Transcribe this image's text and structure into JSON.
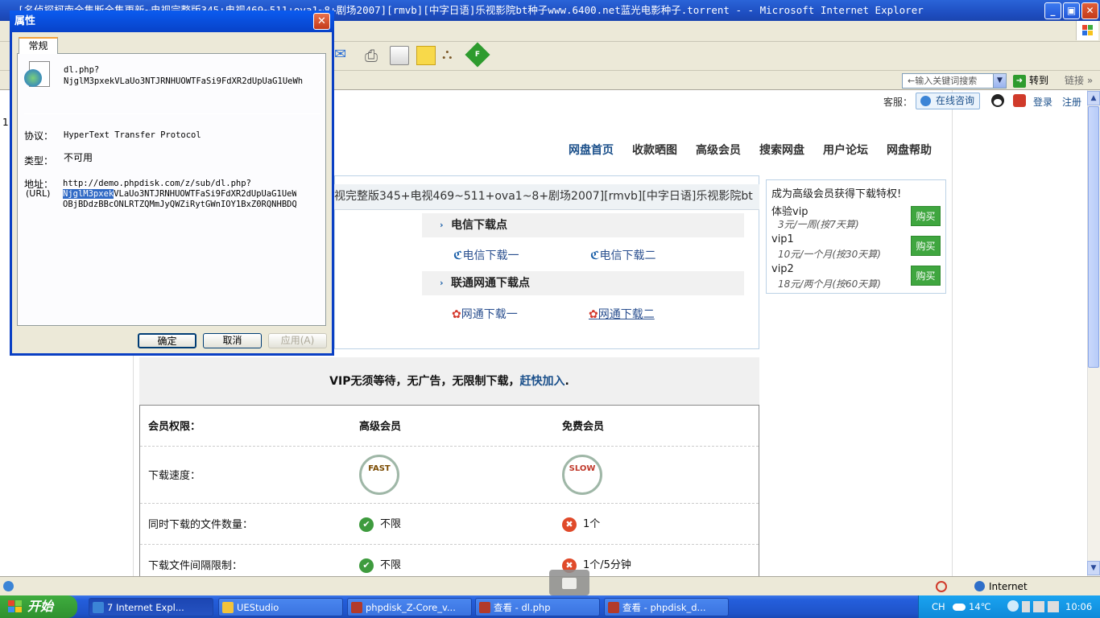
{
  "window": {
    "title": "[名侦探柯南全集断全集更新~电视完整版345+电视469~511+ova1~8+剧场2007][rmvb][中字日语]乐视影院bt种子www.6400.net蓝光电影种子.torrent - - Microsoft Internet Explorer",
    "min": "_",
    "max": "▣",
    "close": "✕"
  },
  "ie": {
    "search_placeholder": "←输入关键词搜索",
    "go_label": "转到",
    "links_label": "链接",
    "status_zone": "Internet"
  },
  "site": {
    "service_label": "客服：",
    "online_label": "在线咨询",
    "login": "登录",
    "register": "注册",
    "nav": [
      "网盘首页",
      "收款晒图",
      "高级会员",
      "搜索网盘",
      "用户论坛",
      "网盘帮助"
    ],
    "file_title": "视完整版345+电视469~511+ova1~8+剧场2007][rmvb][中字日语]乐视影院bt",
    "telecom_head": "电信下载点",
    "telecom_links": [
      "电信下载一",
      "电信下载二"
    ],
    "unicom_head": "联通网通下载点",
    "unicom_links": [
      "网通下载一",
      "网通下载二"
    ],
    "vip_box_title": "成为高级会员获得下载特权!",
    "vip_plans": [
      {
        "name": "体验vip",
        "price": "3元/一周(按7天算)",
        "buy": "购买"
      },
      {
        "name": "vip1",
        "price": "10元/一个月(按30天算)",
        "buy": "购买"
      },
      {
        "name": "vip2",
        "price": "18元/两个月(按60天算)",
        "buy": "购买"
      }
    ],
    "compare_head_a": "VIP无须等待，无广告，无限制下载，",
    "compare_head_link": "赶快加入",
    "compare_head_b": ".",
    "compare_cols": [
      "会员权限：",
      "高级会员",
      "免费会员"
    ],
    "rows": [
      {
        "label": "下载速度：",
        "vip": "FAST",
        "free": "SLOW"
      },
      {
        "label": "同时下载的文件数量：",
        "vip": "不限",
        "free": "1个"
      },
      {
        "label": "下载文件间隔限制：",
        "vip": "不限",
        "free": "1个/5分钟"
      }
    ]
  },
  "dialog": {
    "title": "属性",
    "tab": "常规",
    "file_name_1": "dl.php?",
    "file_name_2": "NjglM3pxekVLaUo3NTJRNHUOWTFaSi9FdXR2dUpUaG1UeWh",
    "protocol_label": "协议：",
    "protocol_value": "HyperText Transfer Protocol",
    "type_label": "类型：",
    "type_value": "不可用",
    "address_label": "地址：",
    "address_label2": "(URL)",
    "url_1": "http://demo.phpdisk.com/z/sub/dl.php?",
    "url_2_sel": "NjglM3pxek",
    "url_2_rest": "VLaUo3NTJRNHUOWTFaSi9FdXR2dUpUaG1UeWh",
    "url_3": "OBjBDdzBBcONLRTZQMmJyQWZiRytGWnIOY1BxZ0RQNHBDQQ",
    "ok": "确定",
    "cancel": "取消",
    "apply": "应用(A)"
  },
  "taskbar": {
    "start": "开始",
    "tasks": [
      "7 Internet Expl...",
      "UEStudio",
      "phpdisk_Z-Core_v...",
      "查看 - dl.php",
      "查看 - phpdisk_d..."
    ],
    "lang": "CH",
    "weather": "14℃",
    "clock": "10:06"
  },
  "page_left_digit": "1"
}
